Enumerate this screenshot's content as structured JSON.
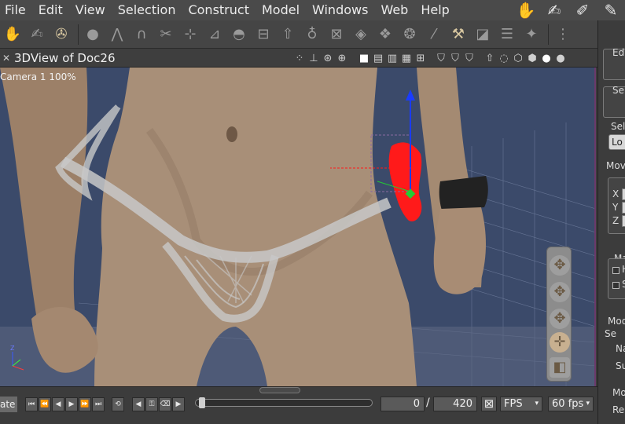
{
  "menubar": {
    "items": [
      "File",
      "Edit",
      "View",
      "Selection",
      "Construct",
      "Model",
      "Windows",
      "Web",
      "Help"
    ]
  },
  "viewheader": {
    "title": "3DView of Doc26"
  },
  "viewport": {
    "camera_label": "Camera 1 100%"
  },
  "rightpanel": {
    "section1": "Ed",
    "section2": "Se",
    "sel_label": "Sel",
    "loc_label": "Lo",
    "mov_label": "Mov",
    "x_label": "X",
    "y_label": "Y",
    "z_label": "Z",
    "ma_label": "Ma",
    "h_label": "H",
    "s_label": "S",
    "mod_label": "Mod",
    "se_label": "Se",
    "na_label": "Na",
    "su_label": "Su",
    "mo_label": "Mo",
    "re_label": "Re"
  },
  "timeline": {
    "rotate_label": "ate",
    "current_frame": "0",
    "separator": "/",
    "end_frame": "420",
    "fps_label": "FPS",
    "fps_value": "60 fps"
  },
  "colors": {
    "selection_red": "#ff1a1a",
    "gizmo_blue": "#1a3cff",
    "gizmo_green": "#22cc33",
    "background_blue": "#3b4a6a"
  }
}
